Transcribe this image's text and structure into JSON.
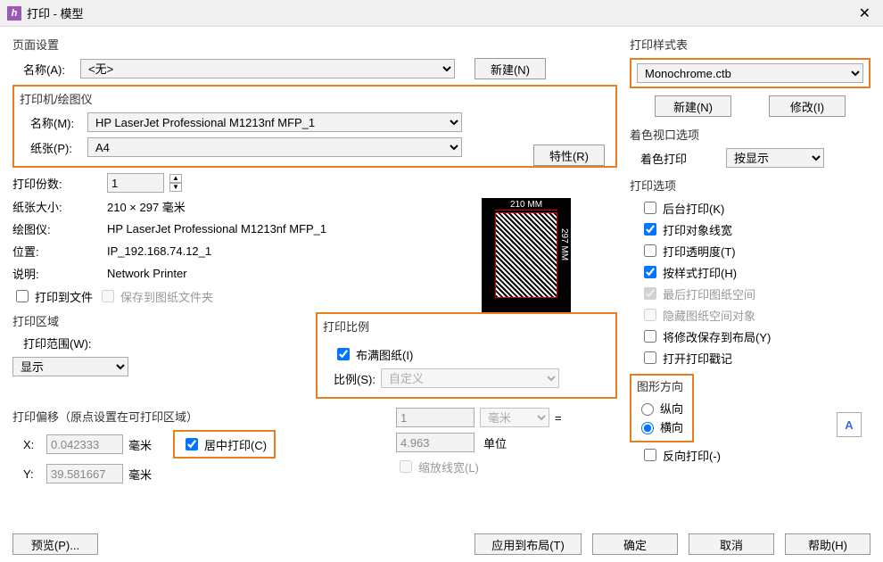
{
  "window": {
    "title": "打印 - 模型"
  },
  "pageSetup": {
    "label": "页面设置",
    "nameLabel": "名称(A):",
    "name": "<无>",
    "newBtn": "新建(N)"
  },
  "printer": {
    "label": "打印机/绘图仪",
    "nameLabel": "名称(M):",
    "name": "HP LaserJet Professional M1213nf MFP_1",
    "paperLabel": "纸张(P):",
    "paper": "A4",
    "propsBtn": "特性(R)",
    "copiesLabel": "打印份数:",
    "copies": "1",
    "sizeLabel": "纸张大小:",
    "size": "210 × 297  毫米",
    "plotterLabel": "绘图仪:",
    "plotter": "HP LaserJet Professional M1213nf MFP_1",
    "locationLabel": "位置:",
    "location": "IP_192.168.74.12_1",
    "descLabel": "说明:",
    "desc": "Network Printer",
    "toFile": "打印到文件",
    "saveFolder": "保存到图纸文件夹"
  },
  "preview": {
    "width": "210 MM",
    "height": "297 MM"
  },
  "printArea": {
    "label": "打印区域",
    "rangeLabel": "打印范围(W):",
    "range": "显示"
  },
  "scale": {
    "label": "打印比例",
    "fit": "布满图纸(I)",
    "scaleLabel": "比例(S):",
    "scale": "自定义",
    "num": "1",
    "unit": "毫米",
    "eq": "=",
    "den": "4.963",
    "denUnit": "单位",
    "scaleLw": "缩放线宽(L)"
  },
  "offset": {
    "label": "打印偏移（原点设置在可打印区域）",
    "x": "0.042333",
    "y": "39.581667",
    "unit": "毫米",
    "center": "居中打印(C)"
  },
  "style": {
    "label": "打印样式表",
    "value": "Monochrome.ctb",
    "newBtn": "新建(N)",
    "modifyBtn": "修改(I)"
  },
  "shade": {
    "label": "着色视口选项",
    "shadeLabel": "着色打印",
    "value": "按显示"
  },
  "options": {
    "label": "打印选项",
    "bg": "后台打印(K)",
    "lw": "打印对象线宽",
    "trans": "打印透明度(T)",
    "byStyle": "按样式打印(H)",
    "lastPs": "最后打印图纸空间",
    "hidePs": "隐藏图纸空间对象",
    "saveLayout": "将修改保存到布局(Y)",
    "stamp": "打开打印戳记"
  },
  "orient": {
    "label": "图形方向",
    "portrait": "纵向",
    "landscape": "横向",
    "reverse": "反向打印(-)"
  },
  "buttons": {
    "preview": "预览(P)...",
    "apply": "应用到布局(T)",
    "ok": "确定",
    "cancel": "取消",
    "help": "帮助(H)"
  }
}
